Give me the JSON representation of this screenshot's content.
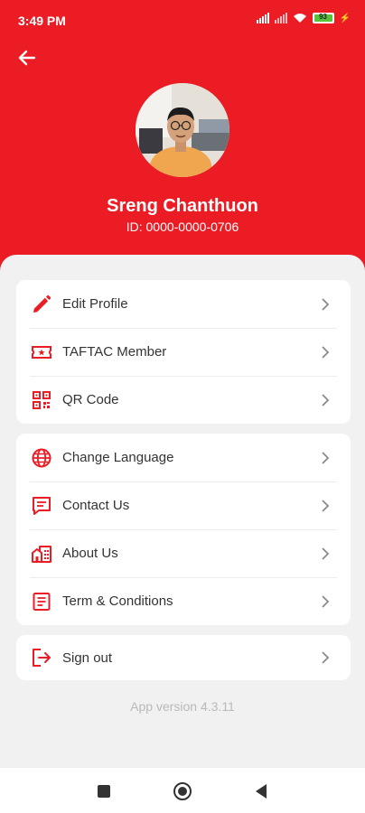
{
  "status_bar": {
    "time": "3:49 PM",
    "battery": "93"
  },
  "profile": {
    "name": "Sreng Chanthuon",
    "id": "ID: 0000-0000-0706"
  },
  "menu_group_1": [
    {
      "label": "Edit Profile",
      "icon": "pencil-icon"
    },
    {
      "label": "TAFTAC Member",
      "icon": "ticket-icon"
    },
    {
      "label": "QR Code",
      "icon": "qr-code-icon"
    }
  ],
  "menu_group_2": [
    {
      "label": "Change Language",
      "icon": "globe-icon"
    },
    {
      "label": "Contact Us",
      "icon": "chat-icon"
    },
    {
      "label": "About Us",
      "icon": "building-icon"
    },
    {
      "label": "Term & Conditions",
      "icon": "document-icon"
    }
  ],
  "menu_group_3": [
    {
      "label": "Sign out",
      "icon": "sign-out-icon"
    }
  ],
  "app_version": "App version 4.3.11",
  "colors": {
    "brand_red": "#ec1c24",
    "background": "#f1f1f1",
    "text": "#333333",
    "muted": "#b9b9b9"
  }
}
